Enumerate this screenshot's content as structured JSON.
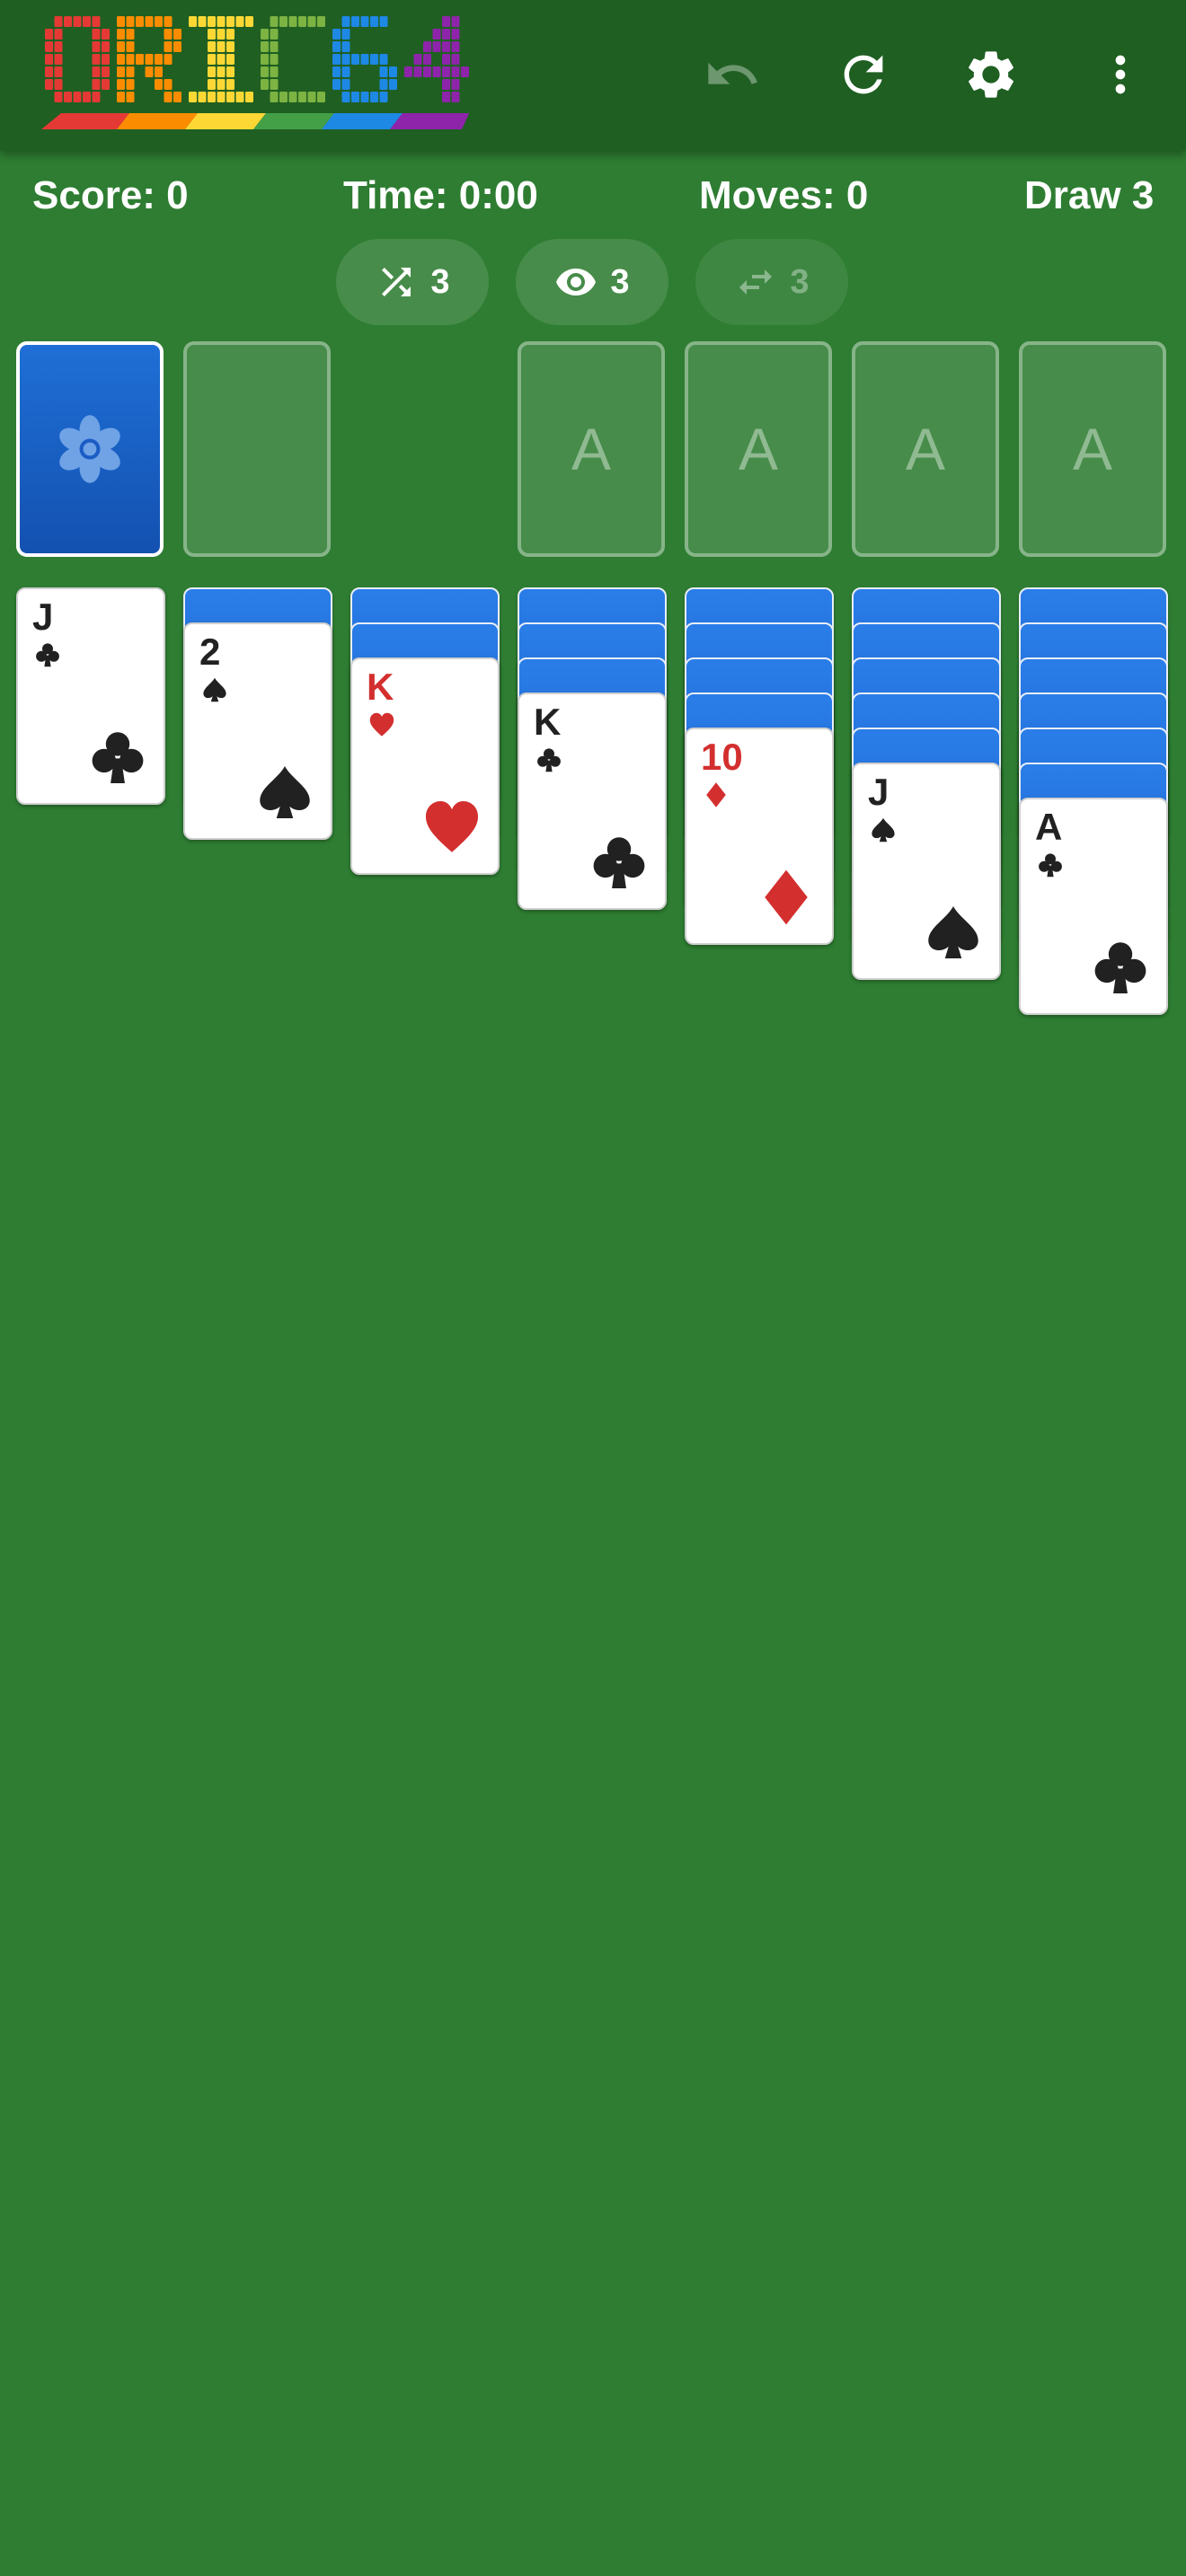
{
  "app": {
    "logo_text": "ORIC64"
  },
  "toolbar": {
    "undo_icon": "undo-icon",
    "restart_icon": "refresh-icon",
    "settings_icon": "gear-icon",
    "menu_icon": "more-vert-icon"
  },
  "stats": {
    "score": "Score: 0",
    "time": "Time: 0:00",
    "moves": "Moves: 0",
    "draw": "Draw 3"
  },
  "hints": {
    "shuffle": "3",
    "peek": "3",
    "swap": "3"
  },
  "foundations": [
    "A",
    "A",
    "A",
    "A"
  ],
  "tableau": [
    {
      "hidden": 0,
      "rank": "J",
      "suit": "clubs",
      "color": "black"
    },
    {
      "hidden": 1,
      "rank": "2",
      "suit": "spades",
      "color": "black"
    },
    {
      "hidden": 2,
      "rank": "K",
      "suit": "hearts",
      "color": "red"
    },
    {
      "hidden": 3,
      "rank": "K",
      "suit": "clubs",
      "color": "black"
    },
    {
      "hidden": 4,
      "rank": "10",
      "suit": "diamonds",
      "color": "red"
    },
    {
      "hidden": 5,
      "rank": "J",
      "suit": "spades",
      "color": "black"
    },
    {
      "hidden": 6,
      "rank": "A",
      "suit": "clubs",
      "color": "black"
    }
  ],
  "colors": {
    "felt": "#2e7d32",
    "topbar": "#1f5f22",
    "card_back": "#1a5cc4",
    "red_suit": "#d32f2f",
    "black_suit": "#212121"
  }
}
